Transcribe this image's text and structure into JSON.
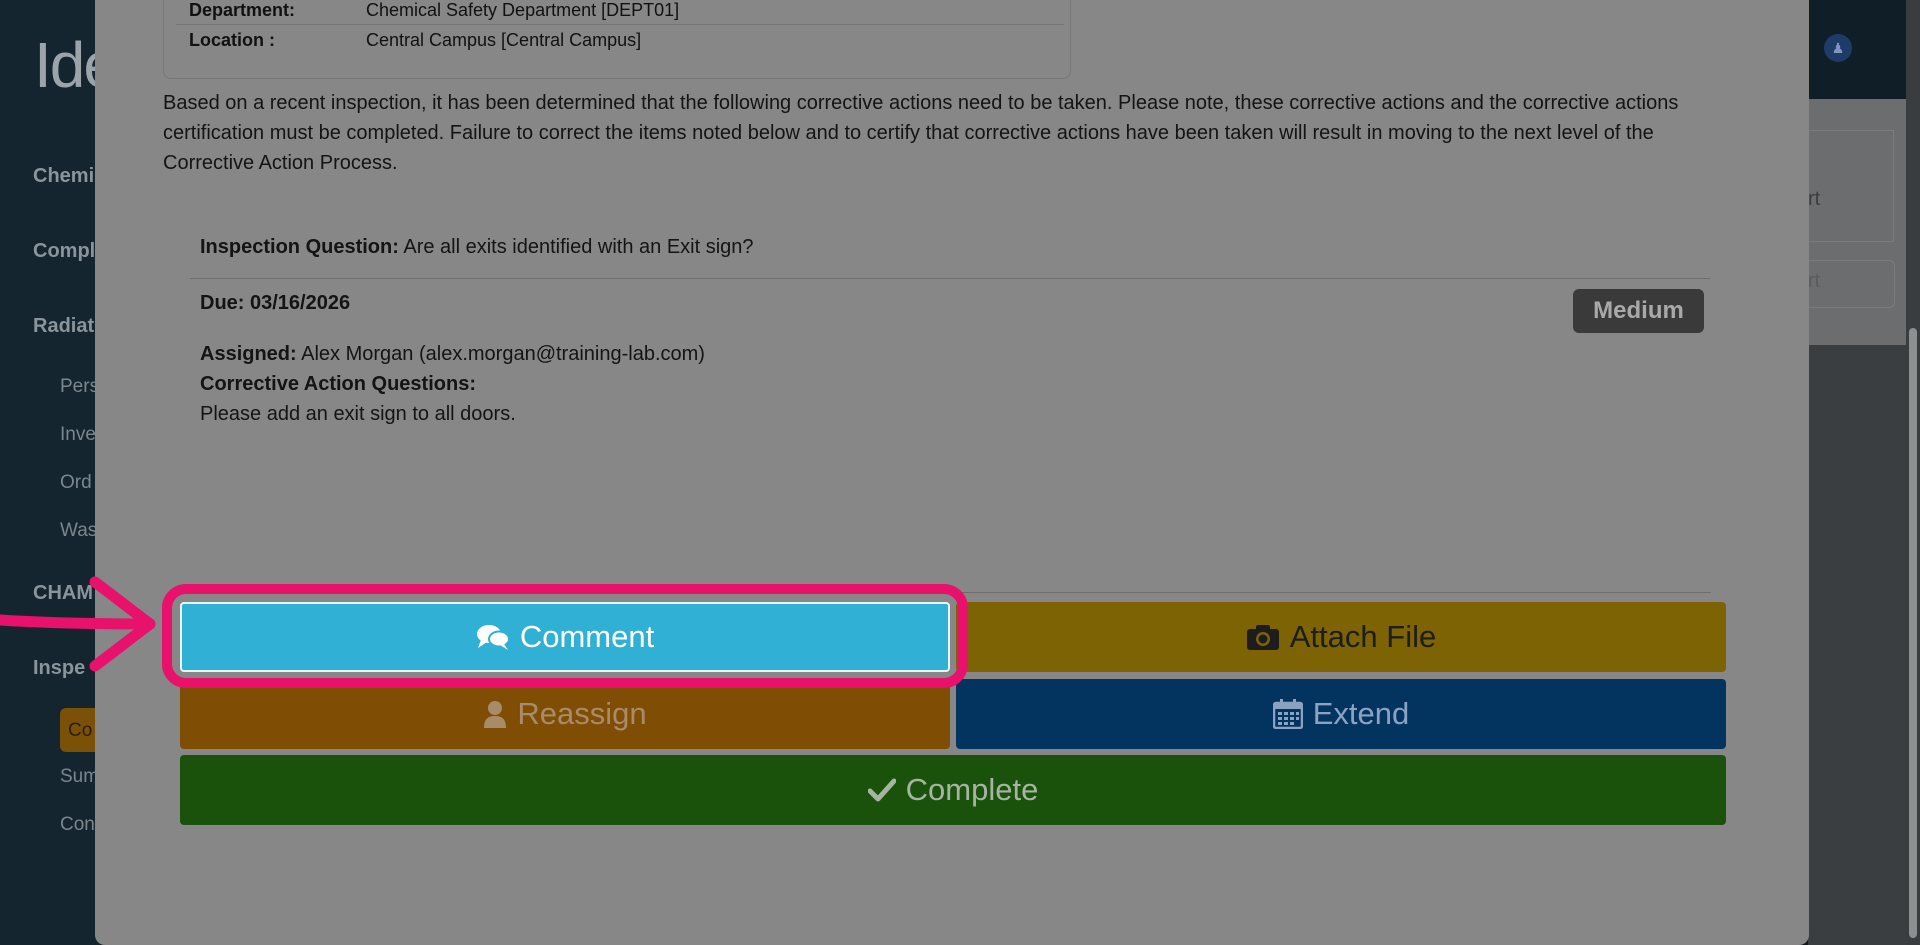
{
  "background_app": {
    "logo_text": "Ide",
    "sidebar": {
      "items": [
        "Chemi",
        "Compl",
        "Radiat",
        "CHAM",
        "Inspe"
      ],
      "sub_items": [
        "Pers",
        "Inve",
        "Ord",
        "Was",
        "Sum",
        "Con"
      ],
      "active_item": "Co"
    },
    "card_texts": [
      "rt",
      "rt"
    ]
  },
  "modal": {
    "info_table": {
      "rows": [
        {
          "label": "Department:",
          "value": "Chemical Safety Department [DEPT01]"
        },
        {
          "label": "Location :",
          "value": "Central Campus [Central Campus]"
        }
      ]
    },
    "intro_text": "Based on a recent inspection, it has been determined that the following corrective actions need to be taken. Please note, these corrective actions and the corrective actions certification must be completed. Failure to correct the items noted below and to certify that corrective actions have been taken will result in moving to the next level of the Corrective Action Process.",
    "finding": {
      "question_label": "Inspection Question:",
      "question_text": "Are all exits identified with an Exit sign?",
      "due": "Due: 03/16/2026",
      "severity_badge": "Medium",
      "assigned_label": "Assigned:",
      "assigned_value": "Alex Morgan (alex.morgan@training-lab.com)",
      "corrective_questions_label": "Corrective Action Questions:",
      "corrective_text": "Please add an exit sign to all doors."
    },
    "buttons": {
      "comment": {
        "label": "Comment",
        "icon": "comments-icon"
      },
      "attach": {
        "label": "Attach File",
        "icon": "camera-icon"
      },
      "reassign": {
        "label": "Reassign",
        "icon": "user-icon"
      },
      "extend": {
        "label": "Extend",
        "icon": "calendar-icon"
      },
      "complete": {
        "label": "Complete",
        "icon": "check-icon"
      }
    }
  },
  "annotation": {
    "highlight_color": "#e8116c",
    "target": "comment"
  },
  "colors": {
    "comment": "#31b0d5",
    "attach": "#7d6303",
    "reassign": "#7f4d03",
    "extend": "#033460",
    "complete": "#1b520b",
    "badge": "#3a3a3a"
  }
}
